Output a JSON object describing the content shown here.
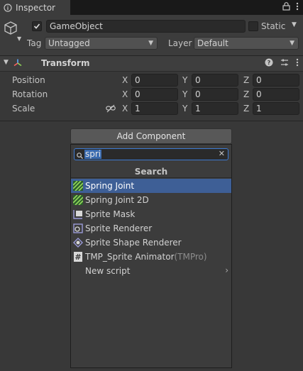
{
  "tab": {
    "label": "Inspector",
    "icon": "info-icon"
  },
  "header": {
    "object_name": "GameObject",
    "static_label": "Static",
    "tag_label": "Tag",
    "tag_value": "Untagged",
    "layer_label": "Layer",
    "layer_value": "Default"
  },
  "transform": {
    "title": "Transform",
    "rows": [
      {
        "label": "Position",
        "x": "0",
        "y": "0",
        "z": "0"
      },
      {
        "label": "Rotation",
        "x": "0",
        "y": "0",
        "z": "0"
      },
      {
        "label": "Scale",
        "x": "1",
        "y": "1",
        "z": "1"
      }
    ],
    "axes": {
      "x": "X",
      "y": "Y",
      "z": "Z"
    }
  },
  "add_component": {
    "button_label": "Add Component",
    "search_value": "spri",
    "section_title": "Search",
    "items": [
      {
        "label": "Spring Joint",
        "icon": "spring-joint-icon",
        "selected": true
      },
      {
        "label": "Spring Joint 2D",
        "icon": "spring-joint-2d-icon"
      },
      {
        "label": "Sprite Mask",
        "icon": "sprite-mask-icon"
      },
      {
        "label": "Sprite Renderer",
        "icon": "sprite-renderer-icon"
      },
      {
        "label": "Sprite Shape Renderer",
        "icon": "sprite-shape-renderer-icon"
      },
      {
        "label": "TMP_Sprite Animator",
        "suffix": "(TMPro)",
        "icon": "script-icon"
      },
      {
        "label": "New script",
        "icon": "chevron-right-icon"
      }
    ]
  },
  "colors": {
    "background": "#383838",
    "selection": "#3e5f96",
    "focus": "#3d7ad2"
  }
}
